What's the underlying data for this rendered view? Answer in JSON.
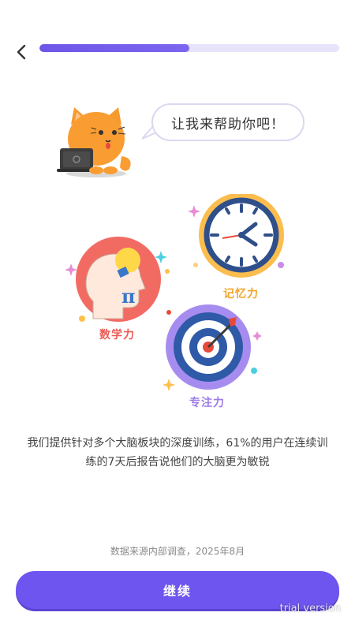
{
  "header": {
    "back_icon": "chevron-left-icon",
    "progress_fraction": 0.5
  },
  "mascot": {
    "icon": "cat-with-laptop-icon",
    "speech": "让我来帮助你吧！"
  },
  "skills": {
    "memory": {
      "label": "记忆力",
      "icon": "clock-icon",
      "color": "#f0a42a"
    },
    "math": {
      "label": "数学力",
      "icon": "head-lightbulb-icon",
      "color": "#ec5a55"
    },
    "focus": {
      "label": "专注力",
      "icon": "target-arrow-icon",
      "color": "#9b7be8"
    }
  },
  "description": "我们提供针对多个大脑板块的深度训练，61%的用户在连续训练的7天后报告说他们的大脑更为敏锐",
  "source_note": "数据来源内部调查，2025年8月",
  "continue_label": "继续",
  "watermark": "trial version",
  "colors": {
    "accent": "#6e55ef",
    "track": "#e7e4fa"
  }
}
